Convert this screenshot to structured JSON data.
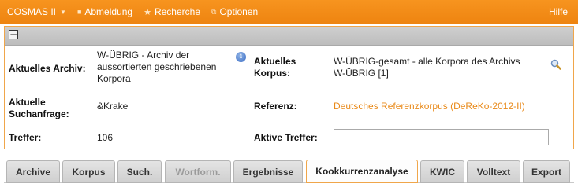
{
  "topbar": {
    "brand": "COSMAS II",
    "menu": [
      {
        "label": "Abmeldung",
        "icon": "logout-icon"
      },
      {
        "label": "Recherche",
        "icon": "star-icon"
      },
      {
        "label": "Optionen",
        "icon": "options-icon"
      }
    ],
    "help": "Hilfe"
  },
  "panel": {
    "collapse_symbol": "−",
    "archiv_label": "Aktuelles Archiv:",
    "archiv_value_lines": [
      "W-ÜBRIG - Archiv der",
      "aussortierten geschriebenen",
      "Korpora"
    ],
    "korpus_label_lines": [
      "Aktuelles",
      "Korpus:"
    ],
    "korpus_value_lines": [
      "W-ÜBRIG-gesamt - alle Korpora des Archivs",
      "W-ÜBRIG [1]"
    ],
    "suchanfrage_label_lines": [
      "Aktuelle",
      "Suchanfrage:"
    ],
    "suchanfrage_value": "&Krake",
    "referenz_label": "Referenz:",
    "referenz_value": "Deutsches Referenzkorpus (DeReKo-2012-II)",
    "treffer_label": "Treffer:",
    "treffer_value": "106",
    "aktive_treffer_label": "Aktive Treffer:",
    "aktive_treffer_value": ""
  },
  "tabs": [
    {
      "label": "Archive",
      "state": "normal"
    },
    {
      "label": "Korpus",
      "state": "normal"
    },
    {
      "label": "Such.",
      "state": "normal"
    },
    {
      "label": "Wortform.",
      "state": "disabled"
    },
    {
      "label": "Ergebnisse",
      "state": "normal"
    },
    {
      "label": "Kookkurrenzanalyse",
      "state": "active"
    },
    {
      "label": "KWIC",
      "state": "normal"
    },
    {
      "label": "Volltext",
      "state": "normal"
    },
    {
      "label": "Export",
      "state": "normal"
    }
  ],
  "colors": {
    "topbar": "#f18a16",
    "panel_border": "#f0a64a",
    "link": "#e98a1a"
  }
}
